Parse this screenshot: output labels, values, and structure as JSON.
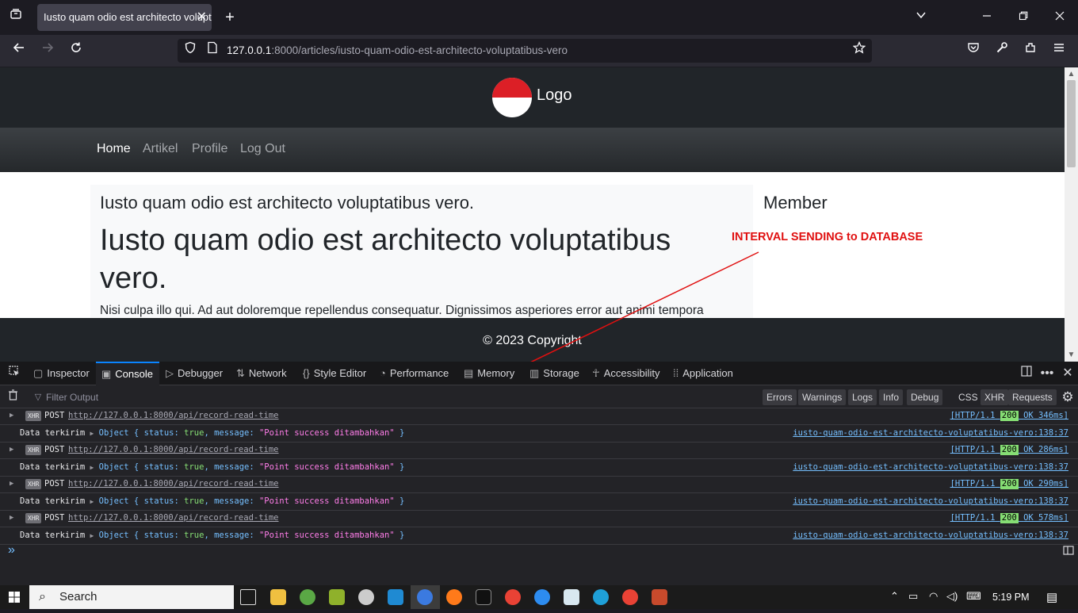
{
  "browser": {
    "tab_title": "Iusto quam odio est architecto voluptatibus vero.",
    "url_host": "127.0.0.1",
    "url_rest": ":8000/articles/iusto-quam-odio-est-architecto-voluptatibus-vero"
  },
  "site": {
    "logo_text": "Logo",
    "nav": [
      "Home",
      "Artikel",
      "Profile",
      "Log Out"
    ],
    "article_subtitle": "Iusto quam odio est architecto voluptatibus vero.",
    "article_title": "Iusto quam odio est architecto voluptatibus vero.",
    "article_body": "Nisi culpa illo qui. Ad aut doloremque repellendus consequatur. Dignissimos asperiores error aut animi tempora",
    "member_title": "Member",
    "footer": "© 2023 Copyright"
  },
  "annotation": "INTERVAL SENDING to DATABASE",
  "devtools": {
    "tabs": [
      "Inspector",
      "Console",
      "Debugger",
      "Network",
      "Style Editor",
      "Performance",
      "Memory",
      "Storage",
      "Accessibility",
      "Application"
    ],
    "filter_placeholder": "Filter Output",
    "filter_levels": [
      "Errors",
      "Warnings",
      "Logs",
      "Info",
      "Debug"
    ],
    "filter_types": [
      "CSS",
      "XHR",
      "Requests"
    ],
    "xhr_badge": "XHR",
    "requests": [
      {
        "method": "POST",
        "url": "http://127.0.0.1:8000/api/record-read-time",
        "proto": "[HTTP/1.1",
        "code": "200",
        "status": "OK 346ms]"
      },
      {
        "method": "POST",
        "url": "http://127.0.0.1:8000/api/record-read-time",
        "proto": "[HTTP/1.1",
        "code": "200",
        "status": "OK 286ms]"
      },
      {
        "method": "POST",
        "url": "http://127.0.0.1:8000/api/record-read-time",
        "proto": "[HTTP/1.1",
        "code": "200",
        "status": "OK 290ms]"
      },
      {
        "method": "POST",
        "url": "http://127.0.0.1:8000/api/record-read-time",
        "proto": "[HTTP/1.1",
        "code": "200",
        "status": "OK 578ms]"
      }
    ],
    "log": {
      "label": "Data terkirim",
      "obj_open": "Object { status: ",
      "bool": "true",
      "mid": ", message: ",
      "message": "\"Point success ditambahkan\"",
      "close": " }",
      "source": "iusto-quam-odio-est-architecto-voluptatibus-vero:138:37"
    }
  },
  "taskbar": {
    "search_label": "Search",
    "time": "5:19 PM"
  }
}
